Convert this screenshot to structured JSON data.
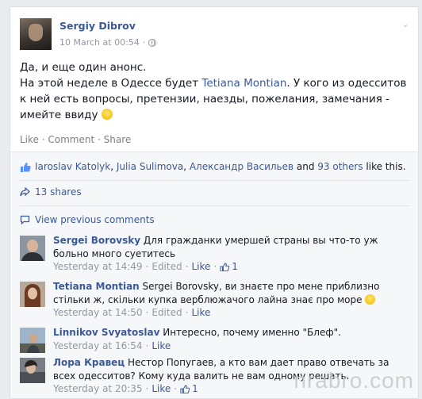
{
  "post": {
    "author": "Sergiy Dibrov",
    "timestamp": "10 March at 00:54",
    "separator": "·",
    "body_line1": "Да, и еще один анонс.",
    "body_line2_pre": "На этой неделе в Одессе будет ",
    "mention": "Tetiana Montian",
    "body_line2_post": ". У кого из одесситов к ней есть вопросы, претензии, наезды, пожелания, замечания - имейте ввиду ",
    "actions": {
      "like": "Like",
      "comment": "Comment",
      "share": "Share",
      "sep": " · "
    }
  },
  "likes": {
    "name1": "Iaroslav Katolyk",
    "sep1": ", ",
    "name2": "Julia Sulimova",
    "sep2": ", ",
    "name3": "Александр Васильев",
    "and": " and ",
    "others": "93 others",
    "suffix": " like this."
  },
  "shares": {
    "label": "13 shares"
  },
  "view_previous": "View previous comments",
  "comments": [
    {
      "author": "Sergei Borovsky",
      "text": " Для гражданки умершей страны вы что-то уж больно много суетитесь",
      "time": "Yesterday at 14:49",
      "edited": "Edited",
      "like": "Like",
      "likes": "1"
    },
    {
      "author": "Tetiana Montian",
      "text": " Sergei Borovsky, ви знаєте про мене приблизно стільки ж, скільки купка верблюжачого лайна знає про море ",
      "time": "Yesterday at 14:50",
      "edited": "Edited",
      "like": "Like"
    },
    {
      "author": "Linnikov Svyatoslav",
      "text": " Интересно, почему именно \"Блеф\".",
      "time": "Yesterday at 16:54",
      "like": "Like"
    },
    {
      "author": "Лора Кравец",
      "text": " Нестор Попугаев, а кто вам дает право отвечать за всех одесситов? Кому куда валить не вам одному решать.",
      "time": "Yesterday at 20:35",
      "like": "Like",
      "likes": "1"
    }
  ],
  "meta_sep": " · ",
  "watermark": "nrabro.com",
  "colors": {
    "link": "#3b5998",
    "meta": "#9197a3",
    "feedback_bg": "#f6f7f9"
  }
}
